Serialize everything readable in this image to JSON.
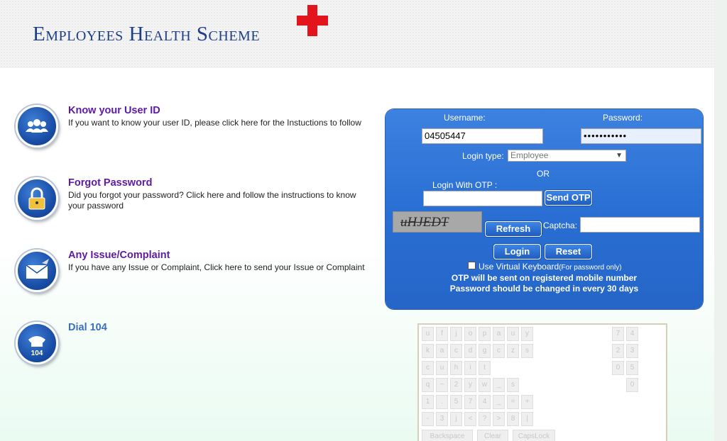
{
  "header": {
    "logo_text": "Employees Health Scheme",
    "logo_cross_color": "#e3141b"
  },
  "info": [
    {
      "icon": "users-icon",
      "title": "Know your User ID",
      "desc": "If you want to know your user ID, please click here for the Instuctions to follow"
    },
    {
      "icon": "lock-icon",
      "title": "Forgot Password",
      "desc": "Did you forgot your password? Click here and follow the instructions to know your password"
    },
    {
      "icon": "mail-icon",
      "title": "Any Issue/Complaint",
      "desc": "If you have any Issue or Complaint, Click here to send your Issue or Complaint"
    },
    {
      "icon": "phone-icon",
      "title": "Dial 104",
      "icon_text": "104"
    }
  ],
  "login": {
    "username_label": "Username:",
    "username_value": "04505447",
    "password_label": "Password:",
    "password_value": "•••••••••••",
    "login_type_label": "Login type:",
    "login_type_selected": "Employee",
    "or_label": "OR",
    "otp_label": "Login With OTP :",
    "otp_value": "",
    "send_otp": "Send OTP",
    "captcha_text": "uHJEDT",
    "refresh": "Refresh",
    "captcha_label": "Captcha:",
    "captcha_value": "",
    "login_button": "Login",
    "reset_button": "Reset",
    "virtual_kbd_label": "Use Virtual Keyboard",
    "virtual_kbd_note": "(For password only)",
    "otp_note": "OTP will be sent on registered mobile number",
    "pw_note": "Password should be changed in every 30 days"
  },
  "keyboard": {
    "rows": [
      [
        "u",
        "f",
        "j",
        "o",
        "p",
        "a",
        "u",
        "y"
      ],
      [
        "k",
        "a",
        "c",
        "d",
        "g",
        "c",
        "z",
        "s"
      ],
      [
        "c",
        "u",
        "h",
        "i",
        "t"
      ],
      [
        "q",
        "~",
        "2",
        "y",
        "w",
        "_",
        "s"
      ],
      [
        "1",
        ".",
        "5",
        "7",
        "4",
        "_",
        "=",
        "+"
      ],
      [
        "-",
        "3",
        "j",
        "<",
        "?",
        ">",
        "8",
        "|"
      ]
    ],
    "side_keys": [
      "7",
      "4",
      "2",
      "3",
      "0",
      "5",
      "0"
    ],
    "bottom_keys": [
      "Backspace",
      "Clear",
      "CapsLock"
    ]
  }
}
